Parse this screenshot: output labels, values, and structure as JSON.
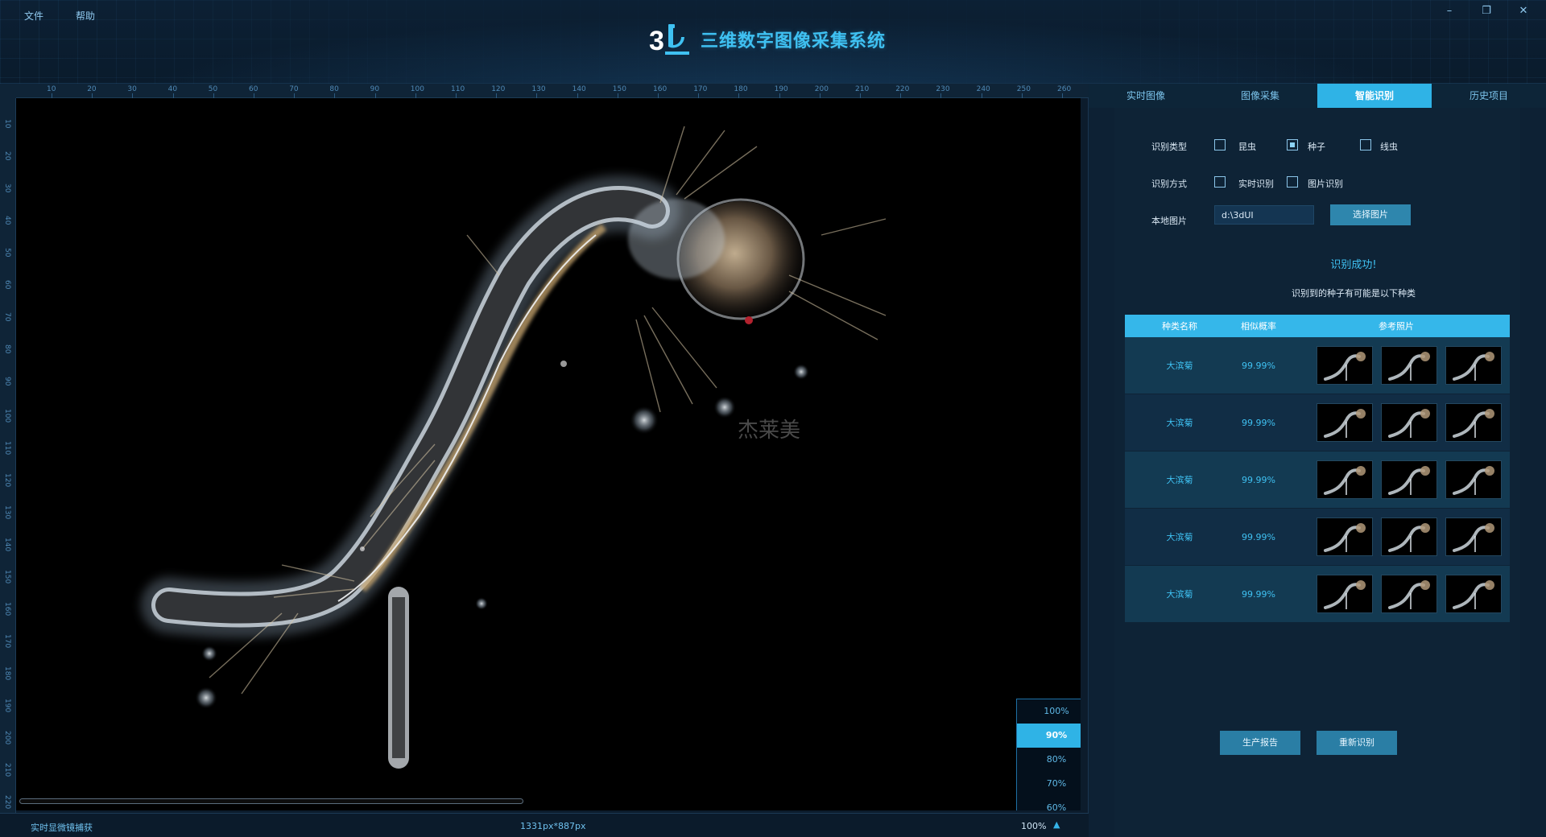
{
  "menu": {
    "file": "文件",
    "help": "帮助"
  },
  "app": {
    "title": "三维数字图像采集系统",
    "logo_text": "3D"
  },
  "window_controls": {
    "minimize": "–",
    "restore": "❐",
    "close": "✕"
  },
  "ruler": {
    "top_labels": [
      "10",
      "20",
      "30",
      "40",
      "50",
      "60",
      "70",
      "80",
      "90",
      "100",
      "110",
      "120",
      "130",
      "140",
      "150",
      "160",
      "170",
      "180",
      "190",
      "200",
      "210",
      "220",
      "230",
      "240",
      "250",
      "260"
    ],
    "left_labels": [
      "10",
      "20",
      "30",
      "40",
      "50",
      "60",
      "70",
      "80",
      "90",
      "100",
      "110",
      "120",
      "130",
      "140",
      "150",
      "160",
      "170",
      "180",
      "190",
      "200",
      "210",
      "220"
    ]
  },
  "viewer": {
    "watermark": "杰莱美"
  },
  "zoom_options": [
    "100%",
    "90%",
    "80%",
    "70%",
    "60%"
  ],
  "zoom_selected": "90%",
  "status": {
    "source": "实时显微镜捕获",
    "resolution": "1331px*887px",
    "zoom": "100%",
    "zoom_caret": "▲"
  },
  "tabs": [
    "实时图像",
    "图像采集",
    "智能识别",
    "历史项目"
  ],
  "active_tab": "智能识别",
  "form": {
    "type_label": "识别类型",
    "type_options": [
      {
        "label": "昆虫",
        "checked": false
      },
      {
        "label": "种子",
        "checked": true
      },
      {
        "label": "线虫",
        "checked": false
      }
    ],
    "mode_label": "识别方式",
    "mode_options": [
      {
        "label": "实时识别",
        "checked": false
      },
      {
        "label": "图片识别",
        "checked": false
      }
    ],
    "local_label": "本地图片",
    "local_path": "d:\\3dUI",
    "select_button": "选择图片"
  },
  "result": {
    "success": "识别成功!",
    "subtitle": "识别到的种子有可能是以下种类",
    "headers": [
      "种类名称",
      "相似概率",
      "参考照片"
    ],
    "rows": [
      {
        "name": "大滨菊",
        "prob": "99.99%"
      },
      {
        "name": "大滨菊",
        "prob": "99.99%"
      },
      {
        "name": "大滨菊",
        "prob": "99.99%"
      },
      {
        "name": "大滨菊",
        "prob": "99.99%"
      },
      {
        "name": "大滨菊",
        "prob": "99.99%"
      }
    ]
  },
  "actions": {
    "report": "生产报告",
    "retry": "重新识别"
  },
  "colors": {
    "accent": "#2fb3e6",
    "title": "#3fc1f2",
    "background": "#0b1a2a"
  }
}
